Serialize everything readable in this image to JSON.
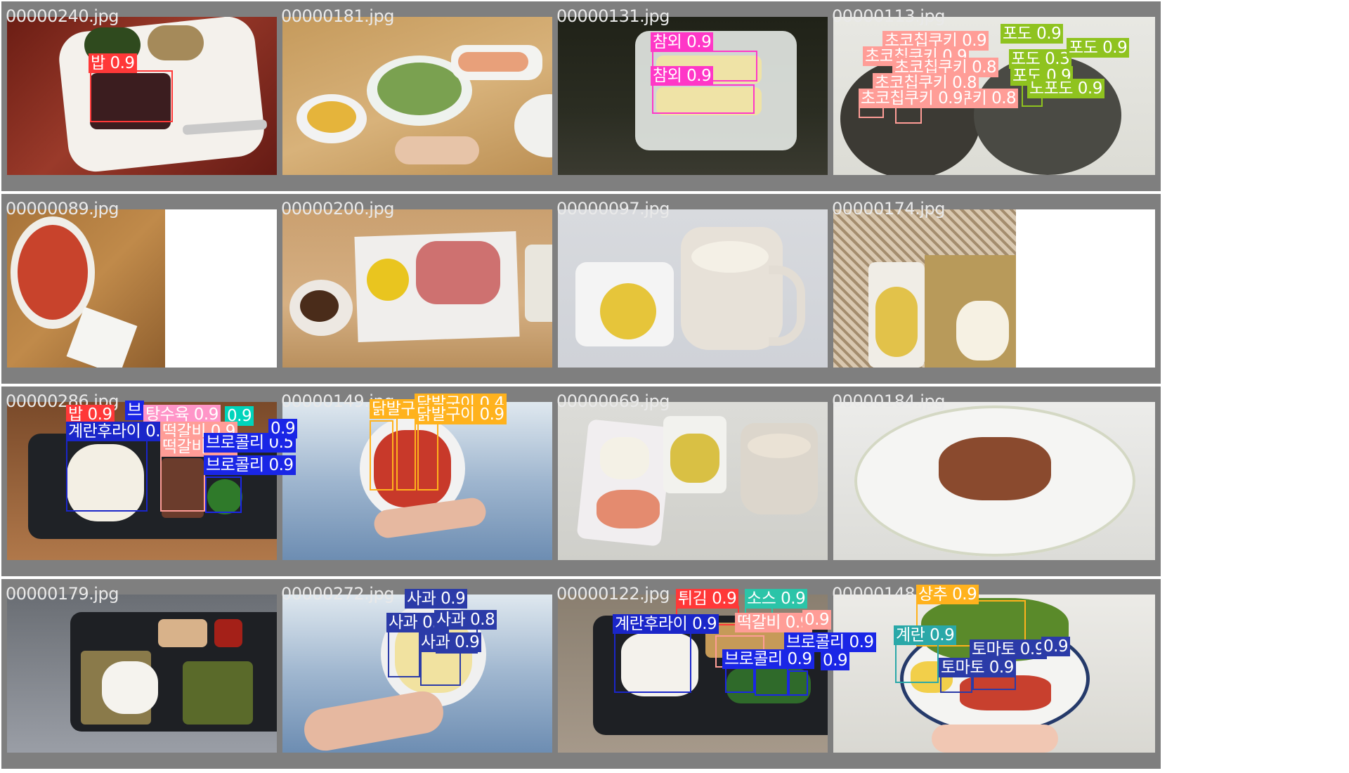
{
  "colors": {
    "rice": "#ff3838",
    "korean_melon": "#ff37c7",
    "choco_cookie": "#ff9d97",
    "grape": "#8fc31f",
    "rolled_egg": "#1a26c9",
    "tangsuyuk": "#ff95c8",
    "tteokgalbi": "#ff9d97",
    "broccoli": "#1a26e6",
    "sauce": "#2bc4a8",
    "chicken_feet": "#ffb21d",
    "apple": "#2b3ba8",
    "fried": "#ff3838",
    "lettuce": "#ffb21d",
    "egg": "#2aa8a8",
    "tomato": "#2b3ba8",
    "green_a": "#00d4bb",
    "blue_b": "#1f3fd2"
  },
  "cells": [
    {
      "filename": "00000240.jpg",
      "labels": [
        {
          "text": "밥 0.9",
          "color": "#ff3838"
        }
      ]
    },
    {
      "filename": "00000181.jpg",
      "labels": []
    },
    {
      "filename": "00000131.jpg",
      "labels": [
        {
          "text": "참외 0.9",
          "color": "#ff37c7"
        },
        {
          "text": "참외 0.9",
          "color": "#ff37c7"
        }
      ]
    },
    {
      "filename": "00000113.jpg",
      "labels": [
        {
          "text": "초코칩쿠키 0.9",
          "color": "#ff9d97"
        },
        {
          "text": "초코칩쿠키 0.9",
          "color": "#ff9d97"
        },
        {
          "text": "초코칩쿠키 0.8",
          "color": "#ff9d97"
        },
        {
          "text": "초코칩쿠키 0.8",
          "color": "#ff9d97"
        },
        {
          "text": "초코칩쿠키 0.8",
          "color": "#ff9d97"
        },
        {
          "text": "초코칩쿠키 0.9",
          "color": "#ff9d97"
        },
        {
          "text": "포도 0.9",
          "color": "#8fc31f"
        },
        {
          "text": "포도 0.3",
          "color": "#8fc31f"
        },
        {
          "text": "포도 0.9",
          "color": "#8fc31f"
        },
        {
          "text": "포도 0.9",
          "color": "#8fc31f"
        },
        {
          "text": "노포도 0.9",
          "color": "#8fc31f"
        }
      ]
    },
    {
      "filename": "00000089.jpg",
      "labels": []
    },
    {
      "filename": "00000200.jpg",
      "labels": []
    },
    {
      "filename": "00000097.jpg",
      "labels": []
    },
    {
      "filename": "00000174.jpg",
      "labels": []
    },
    {
      "filename": "00000286.jpg",
      "labels": [
        {
          "text": "밥 0.9",
          "color": "#ff3838"
        },
        {
          "text": "브",
          "color": "#1a26e6"
        },
        {
          "text": "탕수육 0.9",
          "color": "#ff95c8"
        },
        {
          "text": "0.9",
          "color": "#00d4bb"
        },
        {
          "text": "계란후라이 0.9",
          "color": "#1a26c9"
        },
        {
          "text": "떡갈비 0.9",
          "color": "#ff9d97"
        },
        {
          "text": "떡갈비 0.9",
          "color": "#ff9d97"
        },
        {
          "text": "브로콜리 0.5",
          "color": "#1a26e6"
        },
        {
          "text": "브로콜리 0.9",
          "color": "#1a26e6"
        },
        {
          "text": "0.9",
          "color": "#1a26e6"
        }
      ]
    },
    {
      "filename": "00000149.jpg",
      "labels": [
        {
          "text": "닭발구이 0.4",
          "color": "#ffb21d"
        },
        {
          "text": "닭발구",
          "color": "#ffb21d"
        },
        {
          "text": "닭발구이 0.9",
          "color": "#ffb21d"
        }
      ]
    },
    {
      "filename": "00000069.jpg",
      "labels": []
    },
    {
      "filename": "00000184.jpg",
      "labels": []
    },
    {
      "filename": "00000179.jpg",
      "labels": []
    },
    {
      "filename": "00000272.jpg",
      "labels": [
        {
          "text": "사과 0.9",
          "color": "#2b3ba8"
        },
        {
          "text": "사과 0.9",
          "color": "#2b3ba8"
        },
        {
          "text": "사과 0.8",
          "color": "#2b3ba8"
        },
        {
          "text": "사과 0.9",
          "color": "#2b3ba8"
        }
      ]
    },
    {
      "filename": "00000122.jpg",
      "labels": [
        {
          "text": "튀김 0.9",
          "color": "#ff3838"
        },
        {
          "text": "소스 0.9",
          "color": "#2bc4a8"
        },
        {
          "text": "계란후라이 0.9",
          "color": "#1a26c9"
        },
        {
          "text": "떡갈비 0.9",
          "color": "#ff9d97"
        },
        {
          "text": "0.9",
          "color": "#ff9d97"
        },
        {
          "text": "브로콜리 0.9",
          "color": "#1a26e6"
        },
        {
          "text": "브로콜리 0.9",
          "color": "#1a26e6"
        },
        {
          "text": "0.9",
          "color": "#1a26e6"
        }
      ]
    },
    {
      "filename": "00000148.jpg",
      "labels": [
        {
          "text": "상추 0.9",
          "color": "#ffb21d"
        },
        {
          "text": "계란 0.9",
          "color": "#2aa8a8"
        },
        {
          "text": "토마토 0.9",
          "color": "#2b3ba8"
        },
        {
          "text": "0.9",
          "color": "#2b3ba8"
        },
        {
          "text": "토마토 0.9",
          "color": "#2b3ba8"
        }
      ]
    }
  ]
}
